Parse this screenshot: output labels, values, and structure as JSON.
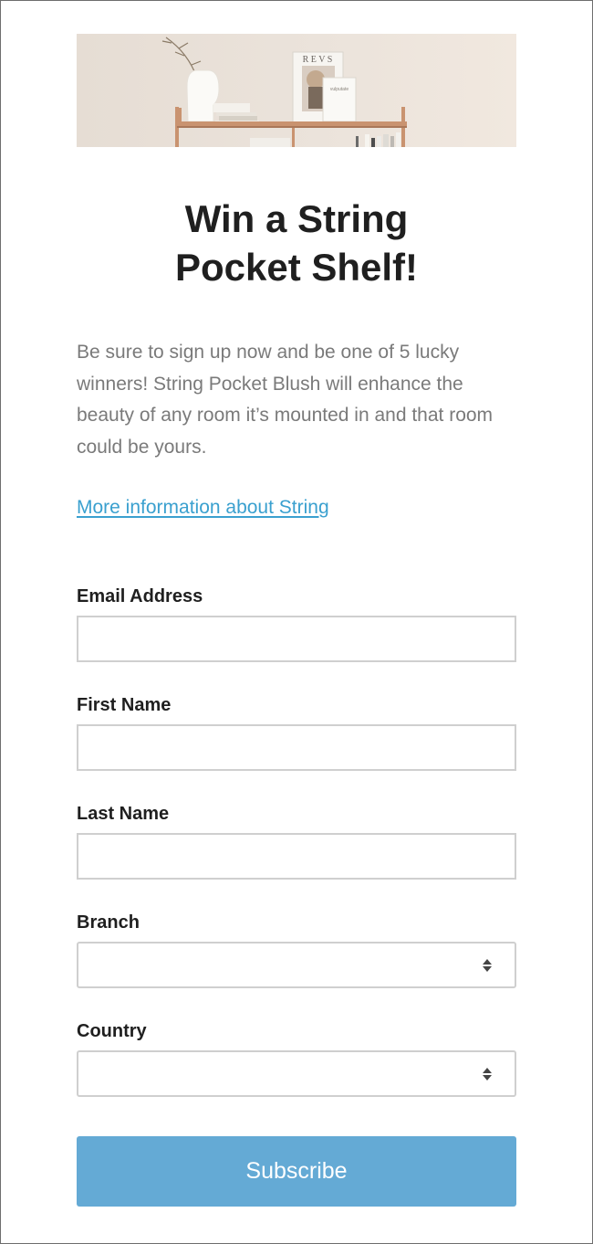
{
  "hero": {
    "magazine_title": "R E V S",
    "small_book_text": "vulputate",
    "colors": {
      "shelf": "#c99370",
      "wall": "#ebe3db"
    }
  },
  "headline": "Win a String\nPocket Shelf!",
  "intro": "Be sure to sign up now and be one of 5 lucky winners! String Pocket Blush will enhance the beauty of any room it’s mounted in and that room could be yours.",
  "more_link": "More information about String",
  "form": {
    "email": {
      "label": "Email Address",
      "value": "",
      "placeholder": ""
    },
    "first_name": {
      "label": "First Name",
      "value": "",
      "placeholder": ""
    },
    "last_name": {
      "label": "Last Name",
      "value": "",
      "placeholder": ""
    },
    "branch": {
      "label": "Branch",
      "selected": "",
      "icon": "updown-icon"
    },
    "country": {
      "label": "Country",
      "selected": "",
      "icon": "updown-icon"
    },
    "subscribe_label": "Subscribe"
  },
  "colors": {
    "accent_button": "#64aad5",
    "link": "#3aa0cf",
    "body_text": "#7a7a7a",
    "heading_text": "#1f1f1f",
    "field_border": "#cfcfcf"
  }
}
